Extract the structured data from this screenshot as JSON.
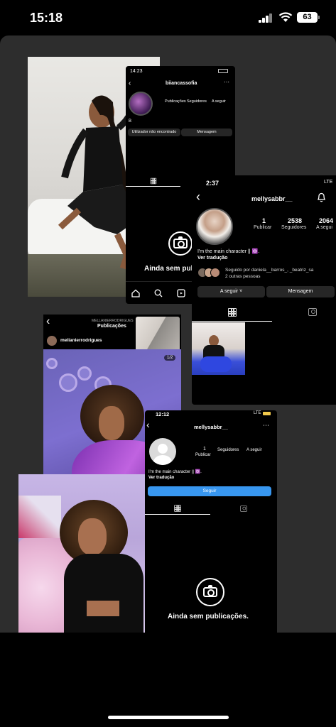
{
  "status_bar": {
    "time": "15:18",
    "battery": "63"
  },
  "screen_a": {
    "time": "14:23",
    "username": "biiancassofia",
    "stats": [
      "Publicações",
      "Seguidores",
      "A seguir"
    ],
    "bio": "B",
    "button_user": "Utilizador não encontrado",
    "button_message": "Mensagem",
    "empty_text": "Ainda sem publi"
  },
  "screen_b": {
    "time": "2:37",
    "carrier": "LTE",
    "username": "mellysabbr__",
    "posts_count": "1",
    "posts_label": "Publicar",
    "followers_count": "2538",
    "followers_label": "Seguidores",
    "following_count": "2064",
    "following_label": "A segui",
    "bio": "I'm the main character || ✡️.",
    "see_translation": "Ver tradução",
    "followed_by": "Seguido por daniela__barros_, _beatriz_sa",
    "followed_more": "2 outras pessoas",
    "button_following": "A seguir ˅",
    "button_message": "Mensagem"
  },
  "screen_c": {
    "header_small": "MELLANIERRODRIGUES",
    "header_title": "Publicações",
    "username": "mellanierrodrigues",
    "page_indicator": "1/2"
  },
  "screen_d": {
    "time": "12:12",
    "carrier": "LTE",
    "username": "mellysabbr__",
    "posts_count": "1",
    "posts_label": "Publicar",
    "followers_label": "Seguidores",
    "following_label": "A seguir",
    "bio": "I'm the main character || ✡️.",
    "see_translation": "Ver tradução",
    "button_follow": "Seguir",
    "empty_text": "Ainda sem publicações."
  },
  "colors": {
    "ig_blue": "#3897f0",
    "btn_dark": "#262626",
    "bg": "#2d2d2d"
  }
}
